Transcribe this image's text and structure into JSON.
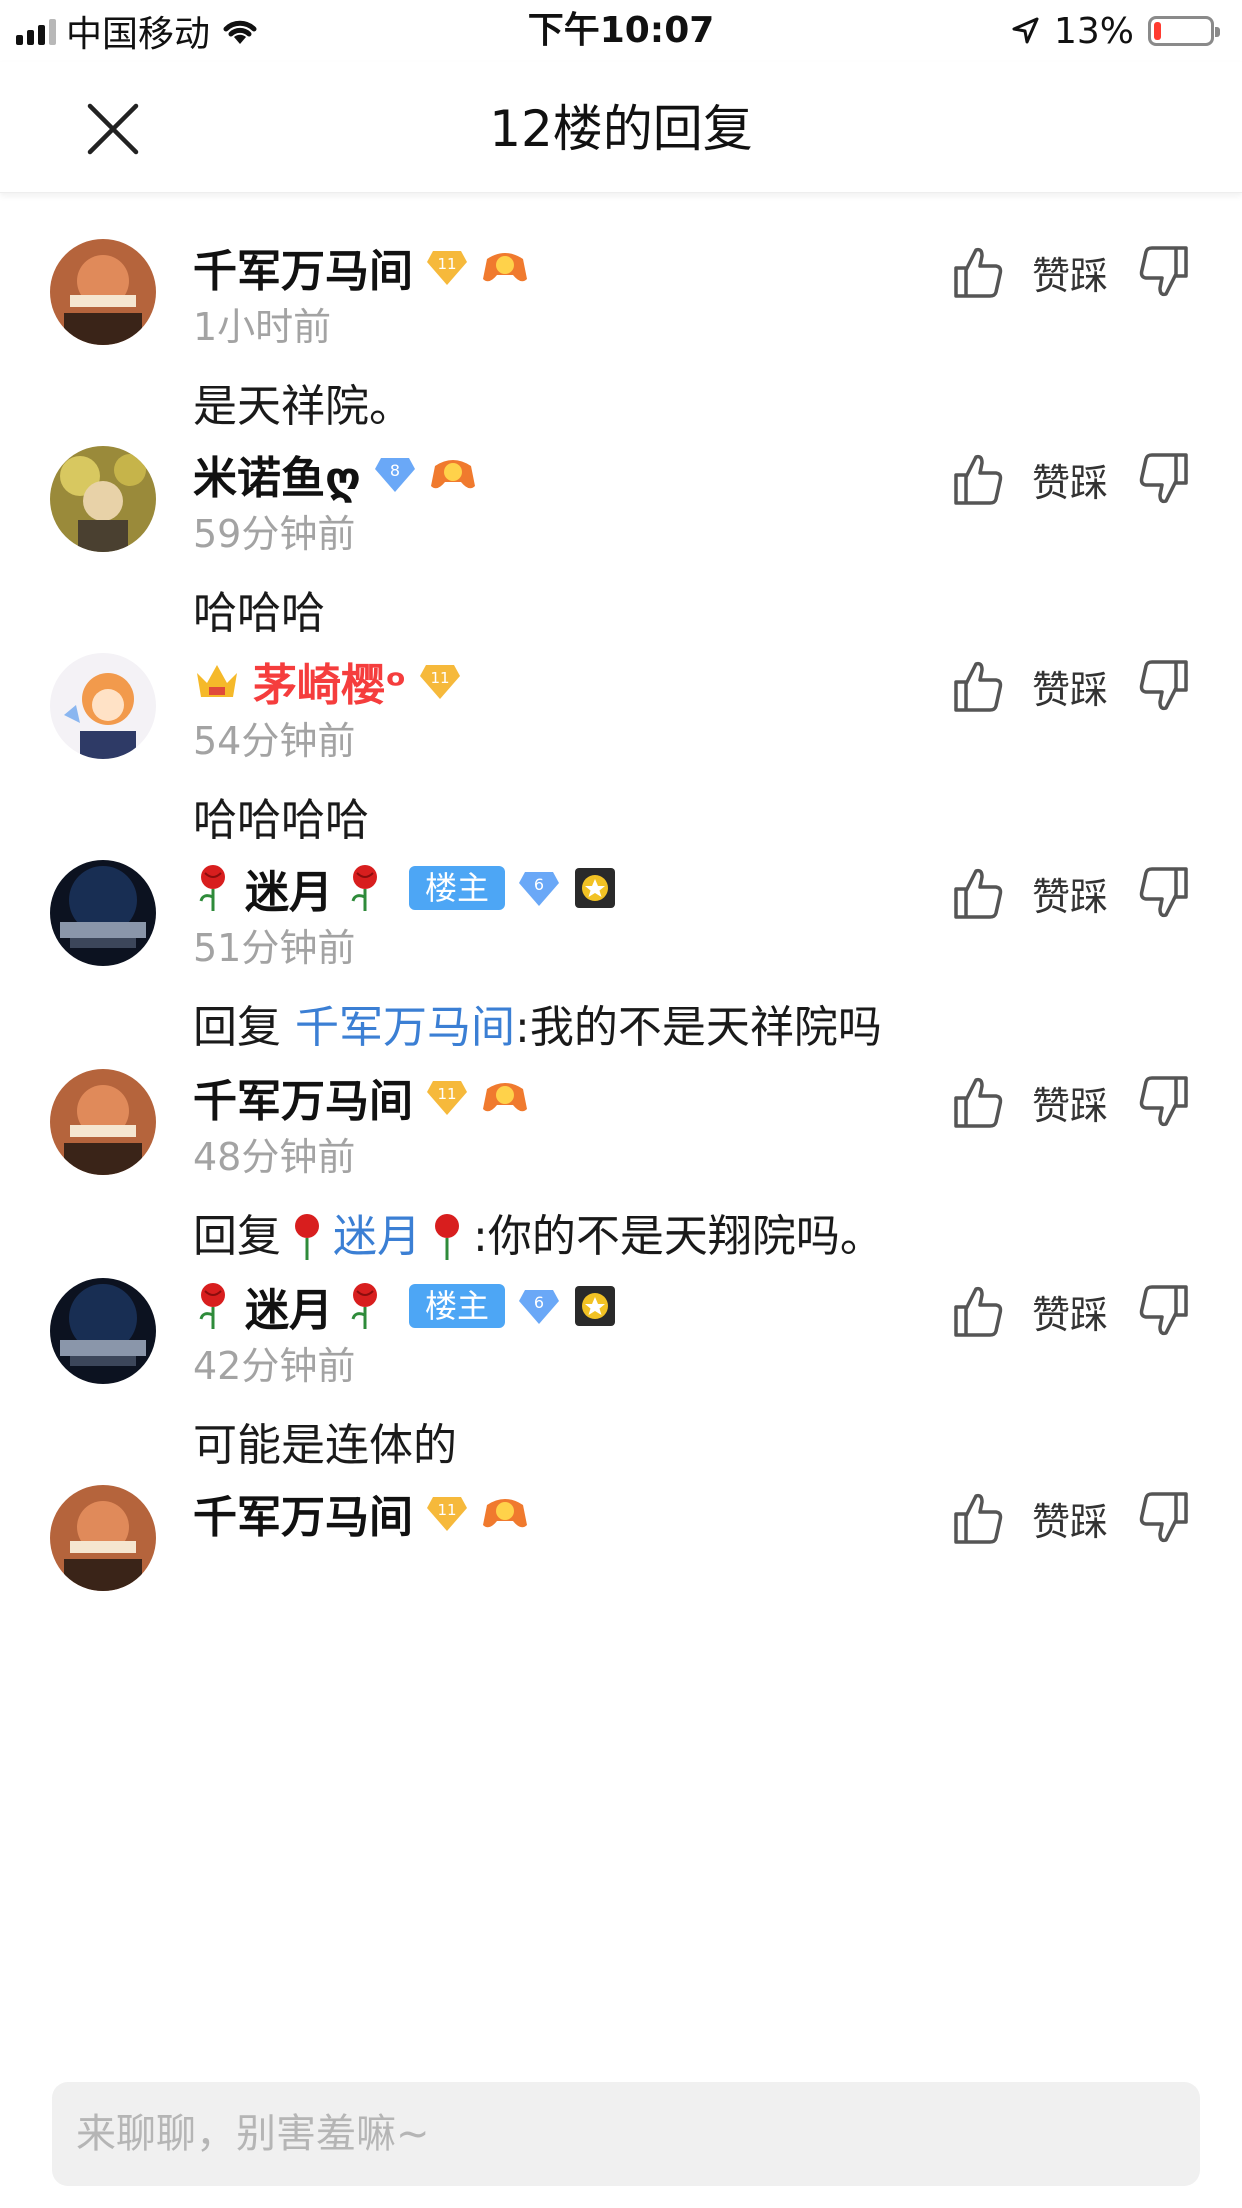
{
  "status_bar": {
    "carrier": "中国移动",
    "time": "下午10:07",
    "battery": "13%",
    "battery_level": 0.13,
    "battery_color": "#ff3b30"
  },
  "header": {
    "title": "12楼的回复",
    "close_icon": "close-icon"
  },
  "action_labels": {
    "like_icon": "thumbs-up-icon",
    "middle_text": "赞踩",
    "dislike_icon": "thumbs-down-icon"
  },
  "replies": [
    {
      "username": "千军万马间",
      "level": "11",
      "time": "1小时前",
      "content": "是天祥院。"
    },
    {
      "username": "米诺鱼ღ",
      "level": "8",
      "time": "59分钟前",
      "content": "哈哈哈"
    },
    {
      "username": "茅崎樱ᵒ",
      "level": "11",
      "time": "54分钟前",
      "content": "哈哈哈哈",
      "name_color": "#f53d3d"
    },
    {
      "username": "迷月",
      "host_label": "楼主",
      "level": "6",
      "time": "51分钟前",
      "content_prefix": "回复 ",
      "mention": "千军万马间",
      "content": ":我的不是天祥院吗"
    },
    {
      "username": "千军万马间",
      "level": "11",
      "time": "48分钟前",
      "content_prefix": "回复 ",
      "mention": "迷月",
      "content": ":你的不是天翔院吗。"
    },
    {
      "username": "迷月",
      "host_label": "楼主",
      "level": "6",
      "time": "42分钟前",
      "content": "可能是连体的"
    },
    {
      "username": "千军万马间",
      "level": "11"
    }
  ],
  "input": {
    "placeholder": "来聊聊，别害羞嘛~"
  },
  "colors": {
    "mention": "#3b7fd4",
    "host_badge": "#4da6f5",
    "level_gold": "#f6b93b",
    "level_blue": "#6aa8f7"
  }
}
